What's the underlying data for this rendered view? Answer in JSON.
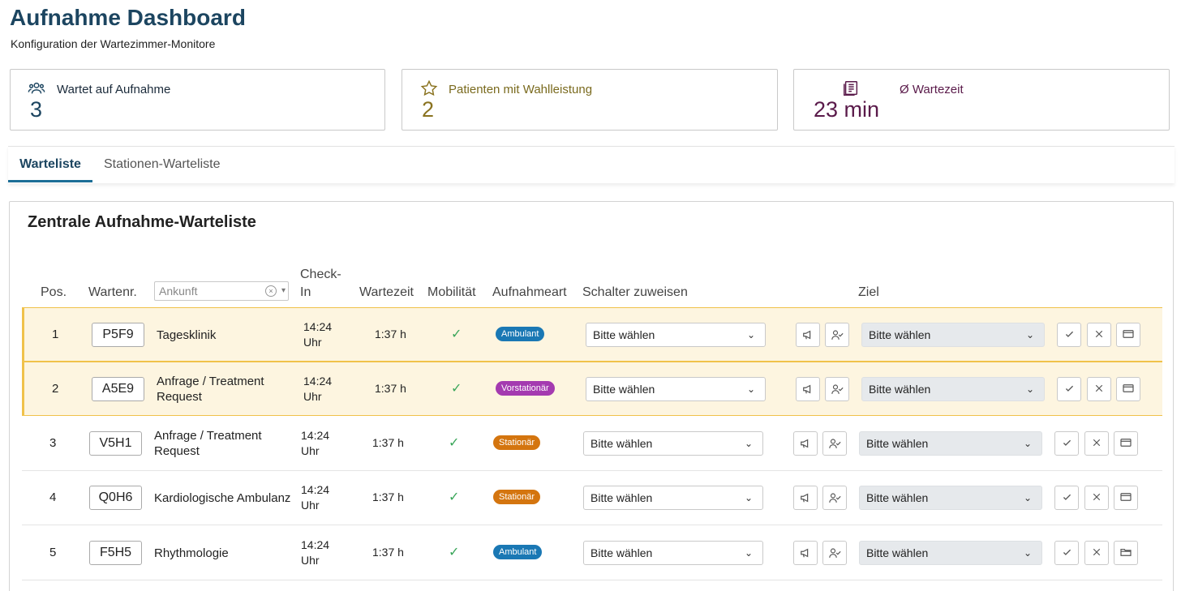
{
  "header": {
    "title": "Aufnahme Dashboard",
    "subtitle": "Konfiguration der Wartezimmer-Monitore"
  },
  "stats": [
    {
      "icon": "users-icon",
      "label": "Wartet auf Aufnahme",
      "value": "3",
      "color": "#1c4560"
    },
    {
      "icon": "star-icon",
      "label": "Patienten mit Wahlleistung",
      "value": "2",
      "color": "#8a7320"
    },
    {
      "icon": "book-icon",
      "label": "Ø Wartezeit",
      "value": "23 min",
      "color": "#5a1a4a"
    }
  ],
  "tabs": [
    {
      "label": "Warteliste",
      "active": true
    },
    {
      "label": "Stationen-Warteliste",
      "active": false
    }
  ],
  "panel": {
    "title": "Zentrale Aufnahme-Warteliste",
    "columns": {
      "pos": "Pos.",
      "ticket": "Wartenr.",
      "checkin_line1": "Check-",
      "checkin_line2": "In",
      "wait": "Wartezeit",
      "mobility": "Mobilität",
      "type": "Aufnahmeart",
      "assign": "Schalter zuweisen",
      "target": "Ziel"
    },
    "filter_placeholder": "Ankunft"
  },
  "rows": [
    {
      "pos": "1",
      "ticket": "P5F9",
      "dept_line1": "Tagesklinik",
      "dept_line2": "",
      "checkin_line1": "14:24",
      "checkin_line2": "Uhr",
      "wait": "1:37 h",
      "mobility": "✓",
      "type": "Ambulant",
      "type_class": "ambulant",
      "assign": "Bitte wählen",
      "target": "Bitte wählen",
      "highlight": true
    },
    {
      "pos": "2",
      "ticket": "A5E9",
      "dept_line1": "Anfrage / Treatment",
      "dept_line2": "Request",
      "checkin_line1": "14:24",
      "checkin_line2": "Uhr",
      "wait": "1:37 h",
      "mobility": "✓",
      "type": "Vorstationär",
      "type_class": "vorstationaer",
      "assign": "Bitte wählen",
      "target": "Bitte wählen",
      "highlight": true
    },
    {
      "pos": "3",
      "ticket": "V5H1",
      "dept_line1": "Anfrage / Treatment",
      "dept_line2": "Request",
      "checkin_line1": "14:24",
      "checkin_line2": "Uhr",
      "wait": "1:37 h",
      "mobility": "✓",
      "type": "Stationär",
      "type_class": "stationaer",
      "assign": "Bitte wählen",
      "target": "Bitte wählen",
      "highlight": false
    },
    {
      "pos": "4",
      "ticket": "Q0H6",
      "dept_line1": "Kardiologische Ambulanz",
      "dept_line2": "",
      "checkin_line1": "14:24",
      "checkin_line2": "Uhr",
      "wait": "1:37 h",
      "mobility": "✓",
      "type": "Stationär",
      "type_class": "stationaer",
      "assign": "Bitte wählen",
      "target": "Bitte wählen",
      "highlight": false
    },
    {
      "pos": "5",
      "ticket": "F5H5",
      "dept_line1": "Rhythmologie",
      "dept_line2": "",
      "checkin_line1": "14:24",
      "checkin_line2": "Uhr",
      "wait": "1:37 h",
      "mobility": "✓",
      "type": "Ambulant",
      "type_class": "ambulant",
      "assign": "Bitte wählen",
      "target": "Bitte wählen",
      "highlight": false
    }
  ]
}
